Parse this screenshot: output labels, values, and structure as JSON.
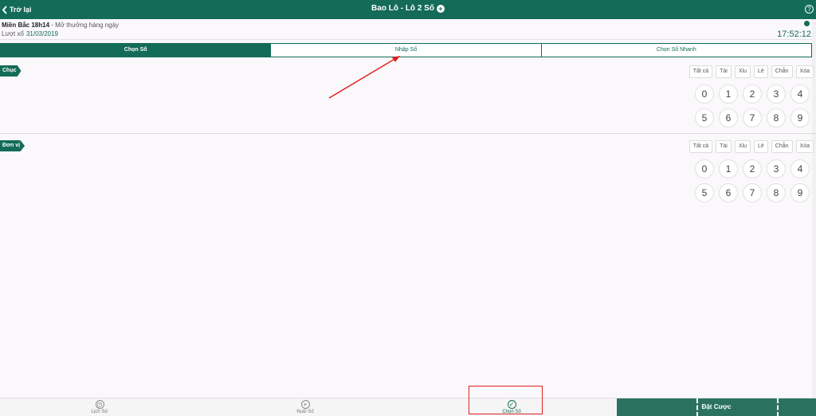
{
  "header": {
    "back_label": "Trở lại",
    "title": "Bao Lô - Lô 2 Số",
    "plus_icon": "plus-circle-icon",
    "help_label": "?"
  },
  "info": {
    "region": "Miền Bắc 18h14",
    "schedule": " - Mở thưởng hàng ngày",
    "draw_label": "Lượt xổ",
    "draw_date": "31/03/2019",
    "clock": "17:52:12"
  },
  "tabs": [
    "Chọn Số",
    "Nhập Số",
    "Chọn Số Nhanh"
  ],
  "sections": [
    {
      "label": "Chục",
      "filters": [
        "Tất cả",
        "Tài",
        "Xỉu",
        "Lẻ",
        "Chẵn",
        "Xóa"
      ],
      "numbers": [
        "0",
        "1",
        "2",
        "3",
        "4",
        "5",
        "6",
        "7",
        "8",
        "9"
      ]
    },
    {
      "label": "Đơn vị",
      "filters": [
        "Tất cả",
        "Tài",
        "Xỉu",
        "Lẻ",
        "Chẵn",
        "Xóa"
      ],
      "numbers": [
        "0",
        "1",
        "2",
        "3",
        "4",
        "5",
        "6",
        "7",
        "8",
        "9"
      ]
    }
  ],
  "bottom": {
    "history": "Lịch Sử",
    "nurture": "Nuôi Số",
    "select": "Chọn Số",
    "bet": "Đặt Cược"
  },
  "colors": {
    "primary": "#136b58",
    "annotation": "#e02020"
  }
}
